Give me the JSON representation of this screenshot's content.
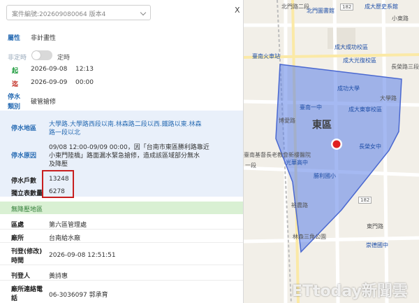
{
  "header": {
    "case_select_value": "案件編號:202609080064 版本4",
    "close_label": "X"
  },
  "attributes": {
    "attr_label": "屬性",
    "attr_value": "非計畫性",
    "toggle_left": "非定時",
    "toggle_right": "定時",
    "start_label": "起",
    "start_date": "2026-09-08",
    "start_time": "12:13",
    "end_label": "迄",
    "end_date": "2026-09-09",
    "end_time": "00:00",
    "type_label_1": "停水",
    "type_label_2": "類別",
    "type_value": "破管搶修"
  },
  "outage": {
    "area_label": "停水地區",
    "area_value_1": "大學路.大學路西段以南.林森路二段以西.鐵路以東.林森",
    "area_value_2": "路一段以北",
    "reason_label": "停水原因",
    "reason_value_1": "09/08 12:00-09/09 00:00，因「台南市東區勝利路靠近",
    "reason_value_2": "小東門陸橋」路面漏水緊急搶修，造成該區域部分無水",
    "reason_value_3": "及降壓",
    "households_label": "停水戶數",
    "households_value": "13248",
    "meters_label": "獨立表數量",
    "meters_value": "6278"
  },
  "low_pressure": {
    "label": "無降壓地區"
  },
  "details": {
    "district_label": "區處",
    "district_value": "第六區管理處",
    "plant_label": "廠所",
    "plant_value": "台南給水廠",
    "publish_label_1": "刊登(修改)",
    "publish_label_2": "時間",
    "publish_value": "2026-09-08 12:51:51",
    "publisher_label": "刊登人",
    "publisher_value": "黃詩惠",
    "phone_label_1": "廠所連絡電",
    "phone_label_2": "話",
    "phone_value": "06-3036097 郭承育"
  },
  "map": {
    "labels": {
      "l1": "北門路二段",
      "l2": "北門圖書館",
      "l3": "小東路",
      "l4": "成功大學",
      "l5": "成大歷史系館",
      "l6": "臺南高商",
      "l7": "成大成功校區",
      "l8": "臺南火車站",
      "l9": "成大光復校區",
      "l10": "長榮路三段",
      "l11": "臺南一中",
      "l12": "博愛路",
      "l13": "成大東寧校區",
      "l14": "東區",
      "l15": "長榮女中",
      "l16": "光華高中",
      "l17": "勝利國小",
      "l18": "臺南基督長老教會新樓醫院",
      "l19": "前鋒路",
      "l20": "裕農路",
      "l21": "東門路",
      "l22": "林森三角公園",
      "l23": "崇德國中",
      "l24": "一段",
      "l25": "大學路",
      "l26": "成大東寧校區",
      "l27": "勝利路",
      "l28": "北門路",
      "l29": "公園南路"
    },
    "road_tag_1": "182",
    "road_tag_2": "182",
    "outage_area_color": "#5b7fe8",
    "marker_color": "#e02020"
  },
  "watermark": "ETtoday新聞雲"
}
